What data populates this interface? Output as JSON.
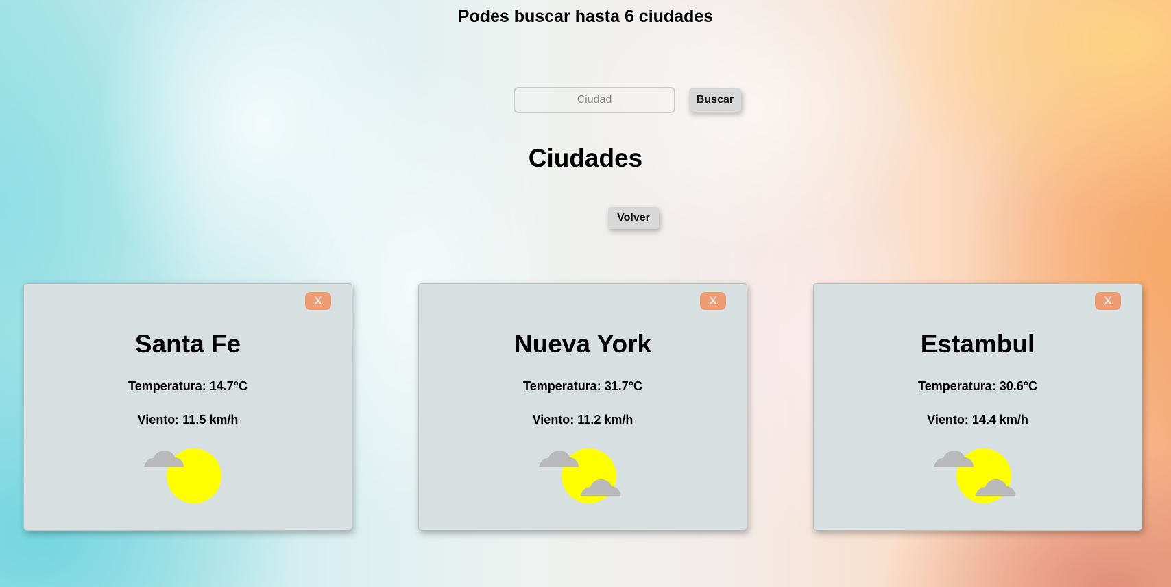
{
  "header": {
    "title": "Podes buscar hasta 6 ciudades"
  },
  "search": {
    "placeholder": "Ciudad",
    "value": "",
    "button_label": "Buscar"
  },
  "cities_section": {
    "title": "Ciudades",
    "back_label": "Volver"
  },
  "colors": {
    "card_bg": "#d7dfe0",
    "close_button": "#ee9c74",
    "sun": "#ffff00",
    "cloud": "#b9b9b9"
  },
  "cards": [
    {
      "close_label": "X",
      "city": "Santa Fe",
      "temperature": "Temperatura: 14.7°C",
      "wind": "Viento: 11.5 km/h",
      "icon": "partly-cloudy-icon"
    },
    {
      "close_label": "X",
      "city": "Nueva York",
      "temperature": "Temperatura: 31.7°C",
      "wind": "Viento: 11.2 km/h",
      "icon": "partly-cloudy-icon"
    },
    {
      "close_label": "X",
      "city": "Estambul",
      "temperature": "Temperatura: 30.6°C",
      "wind": "Viento: 14.4 km/h",
      "icon": "partly-cloudy-icon"
    }
  ]
}
